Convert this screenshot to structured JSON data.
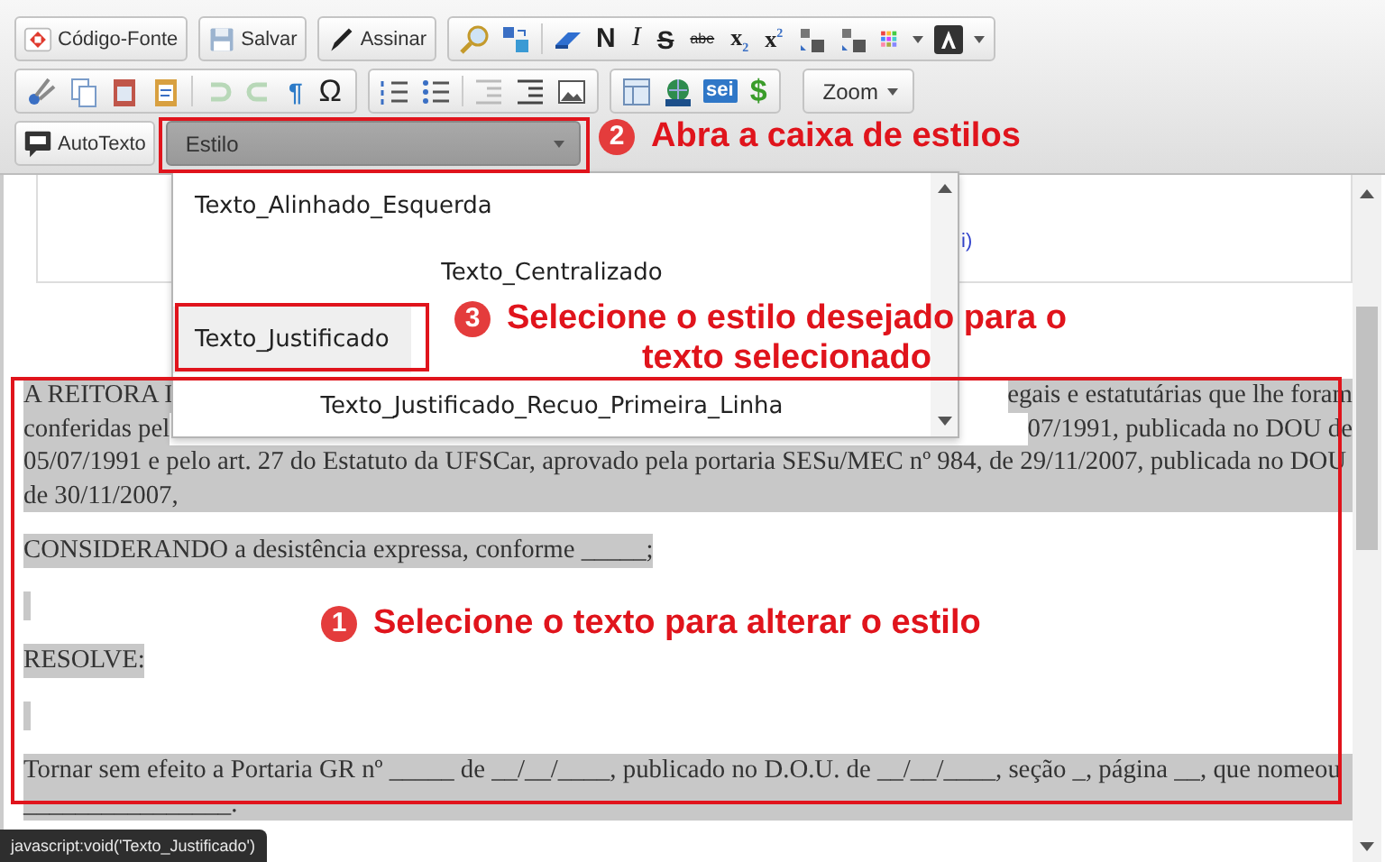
{
  "toolbar": {
    "buttons": [
      {
        "label": "Código-Fonte"
      },
      {
        "label": "Salvar"
      },
      {
        "label": "Assinar"
      },
      {
        "label": "AutoTexto"
      }
    ],
    "glyphs": [
      "N",
      "I",
      "S",
      "abe",
      "x$_{2}$",
      "x$^{2}$",
      "¶",
      "Ω",
      "sei",
      "$"
    ],
    "zoom": {
      "label": "Zoom"
    },
    "style_combo": {
      "label": "Estilo",
      "expanded": true
    }
  },
  "style_menu": {
    "items": [
      {
        "label": "Texto_Alinhado_Esquerda",
        "kind": "left",
        "selected": false
      },
      {
        "label": "Texto_Centralizado",
        "kind": "centered",
        "selected": false
      },
      {
        "label": "Texto_Justificado",
        "kind": "left",
        "selected": true
      },
      {
        "label": "Texto_Justificado_Recuo_Primeira_Linha",
        "kind": "centered",
        "selected": false
      }
    ]
  },
  "document": {
    "header_fragment": "i)",
    "selected": true,
    "paragraphs": [
      {
        "kind": "partial",
        "fragments": [
          {
            "left": "A REITORA I",
            "right": "egais e estatutárias que lhe foram"
          },
          {
            "left": "conferidas pel",
            "right": "07/1991, publicada no DOU de"
          }
        ],
        "text": "05/07/1991 e pelo art. 27 do Estatuto da UFSCar, aprovado pela portaria SESu/MEC nº 984, de 29/11/2007, publicada no DOU de 30/11/2007,"
      },
      {
        "kind": "text",
        "text": "CONSIDERANDO a desistência expressa, conforme _____;"
      },
      {
        "kind": "blank"
      },
      {
        "kind": "text",
        "text": "RESOLVE:"
      },
      {
        "kind": "blank"
      },
      {
        "kind": "text",
        "text": "Tornar sem efeito a Portaria GR nº _____ de __/__/____, publicado no D.O.U. de __/__/____, seção _, página __, que nomeou ________________."
      }
    ]
  },
  "annotations": [
    {
      "number": "2",
      "lines": [
        "Abra a caixa de estilos"
      ]
    },
    {
      "number": "3",
      "lines": [
        "Selecione o estilo desejado para o",
        "texto selecionado"
      ]
    },
    {
      "number": "1",
      "lines": [
        "Selecione o texto para alterar o estilo"
      ]
    }
  ],
  "status_tooltip": "javascript:void('Texto_Justificado')"
}
